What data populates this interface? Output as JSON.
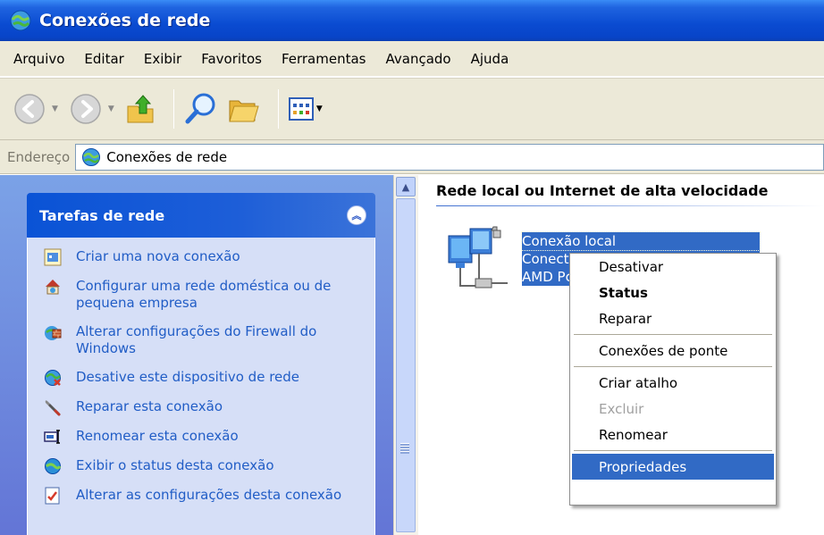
{
  "window": {
    "title": "Conexões de rede",
    "titlebar_color": "#0a4bd1"
  },
  "menu": [
    "Arquivo",
    "Editar",
    "Exibir",
    "Favoritos",
    "Ferramentas",
    "Avançado",
    "Ajuda"
  ],
  "toolbar": {
    "icons": [
      "back-icon",
      "forward-icon",
      "up-folder-icon",
      "search-icon",
      "folders-icon",
      "views-icon"
    ]
  },
  "address": {
    "label": "Endereço",
    "value": "Conexões de rede"
  },
  "taskpane": {
    "title": "Tarefas de rede",
    "tasks": [
      {
        "label": "Criar uma nova conexão",
        "icon": "new-connection-icon"
      },
      {
        "label": "Configurar uma rede doméstica ou de pequena empresa",
        "icon": "home-network-icon"
      },
      {
        "label": "Alterar configurações do Firewall do Windows",
        "icon": "firewall-icon"
      },
      {
        "label": "Desative este dispositivo de rede",
        "icon": "disable-device-icon"
      },
      {
        "label": "Reparar esta conexão",
        "icon": "repair-icon"
      },
      {
        "label": "Renomear esta conexão",
        "icon": "rename-icon"
      },
      {
        "label": "Exibir o status desta conexão",
        "icon": "status-icon"
      },
      {
        "label": "Alterar as configurações desta conexão",
        "icon": "settings-icon"
      }
    ]
  },
  "content": {
    "group_title": "Rede local ou Internet de alta velocidade",
    "connection": {
      "name": "Conexão local",
      "status": "Conectado",
      "device": "AMD PCNET Family PCI Ethernet Adapter",
      "status_visible": "Conect",
      "device_visible": "AMD Pc"
    }
  },
  "context_menu": {
    "items": [
      {
        "label": "Desativar",
        "style": "normal"
      },
      {
        "label": "Status",
        "style": "bold"
      },
      {
        "label": "Reparar",
        "style": "normal"
      },
      {
        "sep": true
      },
      {
        "label": "Conexões de ponte",
        "style": "normal"
      },
      {
        "sep": true
      },
      {
        "label": "Criar atalho",
        "style": "normal"
      },
      {
        "label": "Excluir",
        "style": "disabled"
      },
      {
        "label": "Renomear",
        "style": "normal"
      },
      {
        "sep": true
      },
      {
        "label": "Propriedades",
        "style": "selected"
      }
    ],
    "highlight_color": "#316ac5"
  }
}
